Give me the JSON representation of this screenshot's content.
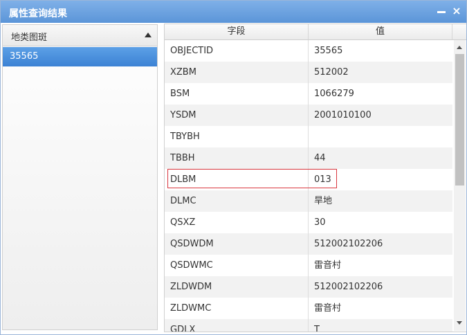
{
  "window": {
    "title": "属性查询结果",
    "minimize_label": "_",
    "close_label": "×"
  },
  "left": {
    "header": "地类图斑",
    "items": [
      {
        "label": "35565",
        "selected": true
      }
    ]
  },
  "grid": {
    "columns": [
      "字段",
      "值"
    ],
    "rows": [
      {
        "field": "OBJECTID",
        "value": "35565"
      },
      {
        "field": "XZBM",
        "value": "512002"
      },
      {
        "field": "BSM",
        "value": "1066279"
      },
      {
        "field": "YSDM",
        "value": "2001010100"
      },
      {
        "field": "TBYBH",
        "value": ""
      },
      {
        "field": "TBBH",
        "value": "44"
      },
      {
        "field": "DLBM",
        "value": "013"
      },
      {
        "field": "DLMC",
        "value": "旱地"
      },
      {
        "field": "QSXZ",
        "value": "30"
      },
      {
        "field": "QSDWDM",
        "value": "512002102206"
      },
      {
        "field": "QSDWMC",
        "value": "雷音村"
      },
      {
        "field": "ZLDWDM",
        "value": "512002102206"
      },
      {
        "field": "ZLDWMC",
        "value": "雷音村"
      },
      {
        "field": "GDLX",
        "value": "T"
      }
    ],
    "highlighted_field": "DLBM"
  },
  "colors": {
    "titlebar": "#5b95d8",
    "selected_item": "#3c82d4",
    "highlight_border": "#d9363e"
  }
}
